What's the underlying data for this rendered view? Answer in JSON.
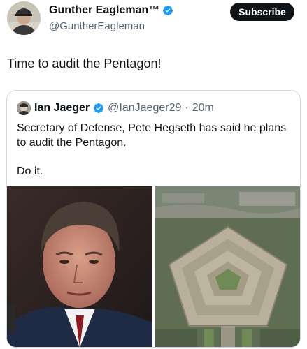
{
  "author": {
    "name": "Gunther Eagleman™",
    "handle": "@GuntherEagleman",
    "subscribe_label": "Subscribe",
    "avatar_icon": "profile-photo",
    "verified_icon": "verified-badge"
  },
  "post": {
    "text": "Time to audit the Pentagon!"
  },
  "quoted_post": {
    "name": "Ian Jaeger",
    "handle": "@IanJaeger29",
    "separator": "·",
    "time": "20m",
    "text_line": "Secretary of Defense, Pete Hegseth has said he plans to audit the Pentagon.",
    "text_line2": "Do it.",
    "media": [
      {
        "subject": "portrait-photo"
      },
      {
        "subject": "pentagon-aerial-photo"
      }
    ]
  },
  "colors": {
    "accent_verified": "#1d9bf0",
    "text_primary": "#0f1419",
    "text_secondary": "#536471",
    "border": "#cfd9de"
  }
}
